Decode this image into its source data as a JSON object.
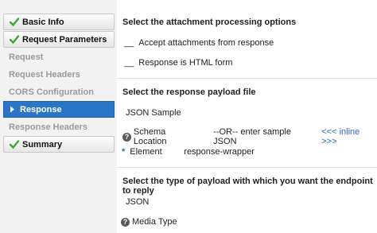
{
  "sidebar": {
    "items": [
      {
        "label": "Basic Info",
        "state": "done"
      },
      {
        "label": "Request Parameters",
        "state": "done"
      },
      {
        "label": "Request",
        "state": "pending"
      },
      {
        "label": "Request Headers",
        "state": "pending"
      },
      {
        "label": "CORS Configuration",
        "state": "pending"
      },
      {
        "label": "Response",
        "state": "active"
      },
      {
        "label": "Response Headers",
        "state": "pending"
      },
      {
        "label": "Summary",
        "state": "done"
      }
    ]
  },
  "attachments": {
    "heading": "Select the attachment processing options",
    "option1_blank": "__",
    "option1_label": "Accept attachments from response",
    "option2_blank": "__",
    "option2_label": "Response is HTML form"
  },
  "payload_file": {
    "heading": "Select the response payload file",
    "file_type": "JSON Sample",
    "schema_label": "Schema Location",
    "or_text": "--OR-- enter sample JSON",
    "inline_link": "<<< inline >>>",
    "required_mark": "*",
    "element_label": "Element",
    "element_value": "response-wrapper"
  },
  "payload_type": {
    "heading": "Select the type of payload with which you want the endpoint to reply",
    "type_value": "JSON",
    "media_label": "Media Type"
  },
  "colors": {
    "active": "#2a76c6",
    "check": "#3aa62f",
    "link": "#2a66c4"
  },
  "icons": {
    "check": "check-icon",
    "help": "help-icon",
    "active_arrow": "arrow-right-icon"
  }
}
